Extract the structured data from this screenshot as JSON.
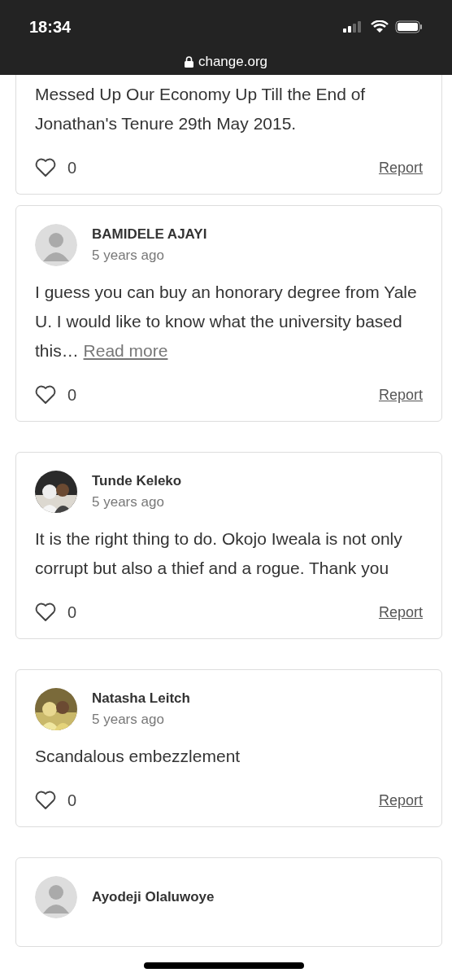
{
  "status_bar": {
    "time": "18:34",
    "url": "change.org"
  },
  "comments": [
    {
      "kind": "continued",
      "text": "Messed Up Our Economy Up Till the End of Jonathan's Tenure 29th May 2015.",
      "likes": "0",
      "liked": false,
      "report": "Report"
    },
    {
      "kind": "default_avatar",
      "author": "BAMIDELE AJAYI",
      "time": "5 years ago",
      "text": "I guess you can buy an honorary degree from Yale U. I would like to know what the university based this…",
      "read_more": "Read more",
      "likes": "0",
      "liked": false,
      "report": "Report"
    },
    {
      "kind": "photo_avatar",
      "author": "Tunde Keleko",
      "time": "5 years ago",
      "text": "It is the right thing to do. Okojo Iweala is not only corrupt but also a thief and a rogue. Thank you",
      "likes": "0",
      "liked": false,
      "report": "Report"
    },
    {
      "kind": "photo_avatar",
      "author": "Natasha Leitch",
      "time": "5 years ago",
      "text": "Scandalous embezzlement",
      "likes": "0",
      "liked": false,
      "report": "Report"
    },
    {
      "kind": "default_avatar",
      "author": "Ayodeji Olaluwoye"
    }
  ]
}
